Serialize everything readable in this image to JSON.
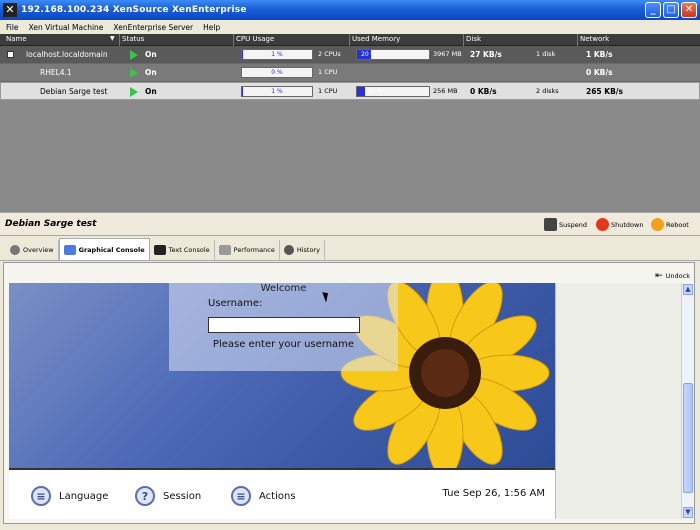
{
  "window": {
    "title": "192.168.100.234 XenSource XenEnterprise"
  },
  "menu": [
    "File",
    "Xen Virtual Machine",
    "XenEnterprise Server",
    "Help"
  ],
  "columns": {
    "name": "Name",
    "status": "Status",
    "cpu": "CPU Usage",
    "memory": "Used Memory",
    "disk": "Disk",
    "network": "Network"
  },
  "vms": [
    {
      "name": "localhost.localdomain",
      "status": "On",
      "cpu_pct": 1,
      "cpu_label": "1 %",
      "cpus": "2 CPUs",
      "mem_pct": 20,
      "mem_label": "20 %",
      "mem_total": "3967 MB",
      "disk_rate": "27 KB/s",
      "disks": "1 disk",
      "network": "1 KB/s"
    },
    {
      "name": "RHEL4.1",
      "status": "On",
      "cpu_pct": 0,
      "cpu_label": "0 %",
      "cpus": "1 CPU",
      "mem_pct": null,
      "mem_label": "",
      "mem_total": "",
      "disk_rate": "",
      "disks": "",
      "network": "0 KB/s"
    },
    {
      "name": "Debian Sarge test",
      "status": "On",
      "cpu_pct": 1,
      "cpu_label": "1 %",
      "cpus": "1 CPU",
      "mem_pct": 11,
      "mem_label": "11 %",
      "mem_total": "256 MB",
      "disk_rate": "0 KB/s",
      "disks": "2 disks",
      "network": "265 KB/s"
    }
  ],
  "selected_vm": "Debian Sarge test",
  "actions": {
    "suspend": "Suspend",
    "shutdown": "Shutdown",
    "reboot": "Reboot"
  },
  "tabs": [
    {
      "label": "Overview",
      "icon": "overview-icon"
    },
    {
      "label": "Graphical Console",
      "icon": "monitor-icon"
    },
    {
      "label": "Text Console",
      "icon": "terminal-icon"
    },
    {
      "label": "Performance",
      "icon": "chart-icon"
    },
    {
      "label": "History",
      "icon": "history-icon"
    }
  ],
  "console": {
    "undock": "Undock",
    "welcome": "Welcome",
    "username_label": "Username:",
    "hint": "Please enter your username",
    "bottom": {
      "language": "Language",
      "session": "Session",
      "actions": "Actions"
    },
    "clock": "Tue Sep 26,  1:56 AM"
  },
  "colors": {
    "titlebar": "#1c5fd6",
    "bar_fill": "#2830d8",
    "status_on": "#3cc24a"
  }
}
